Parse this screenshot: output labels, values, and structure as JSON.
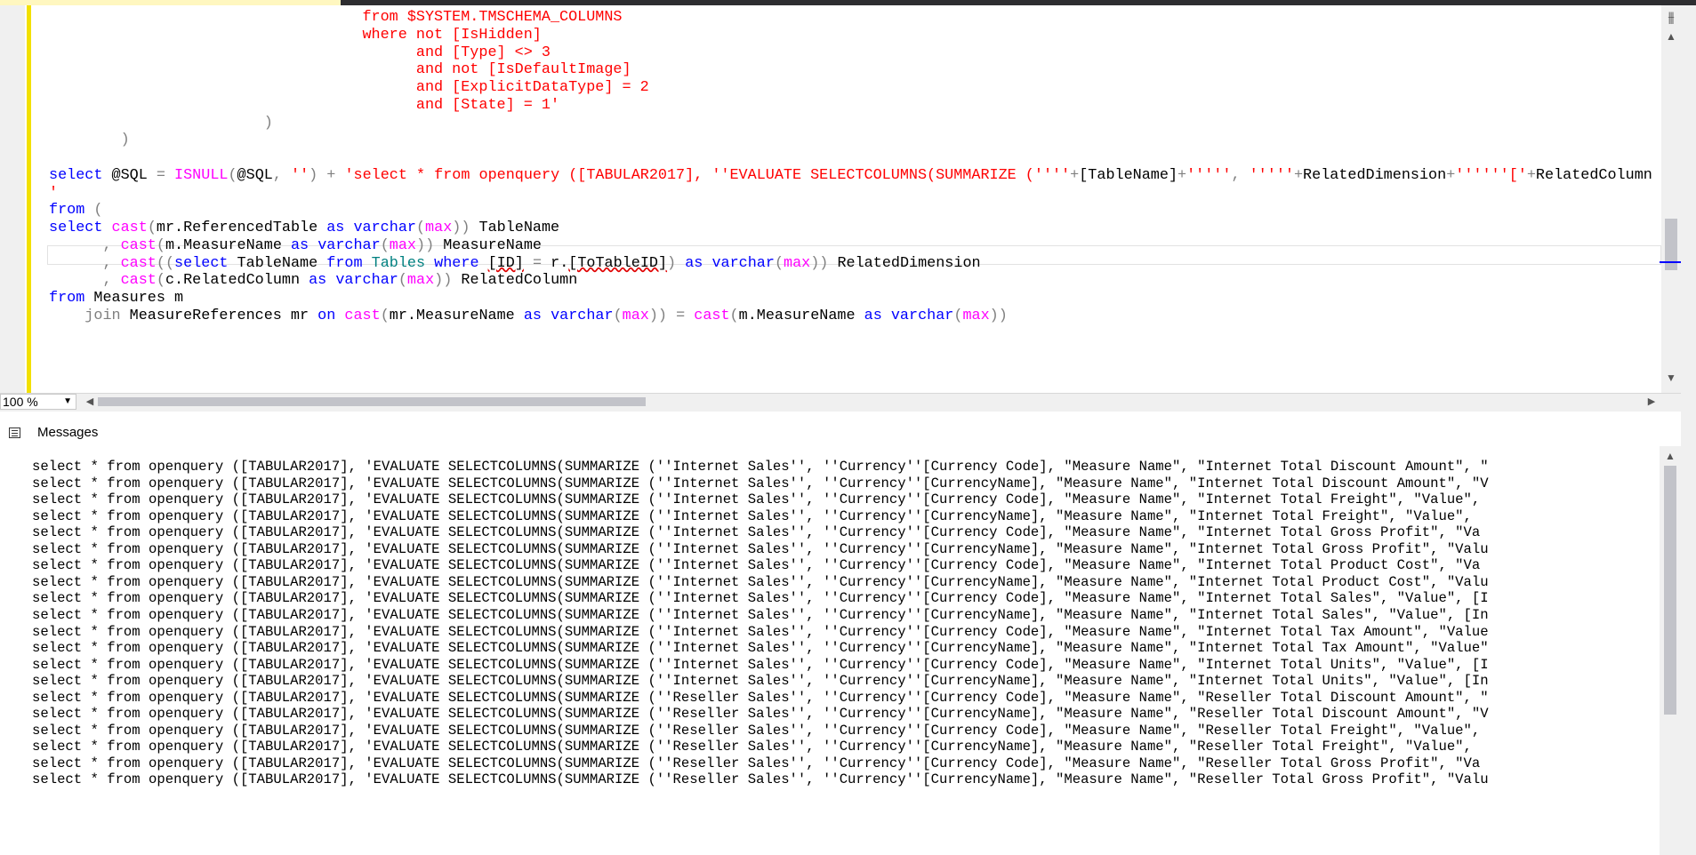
{
  "editor": {
    "lines": [
      [
        {
          "t": "                                   from $SYSTEM.TMSCHEMA_COLUMNS",
          "c": "str"
        }
      ],
      [
        {
          "t": "                                   where not [IsHidden]",
          "c": "str"
        }
      ],
      [
        {
          "t": "                                         and [Type] <> 3",
          "c": "str"
        }
      ],
      [
        {
          "t": "                                         and not [IsDefaultImage]",
          "c": "str"
        }
      ],
      [
        {
          "t": "                                         and [ExplicitDataType] = 2",
          "c": "str"
        }
      ],
      [
        {
          "t": "                                         and [State] = 1'",
          "c": "str"
        }
      ],
      [
        {
          "t": "                        )",
          "c": "op"
        }
      ],
      [
        {
          "t": "        )",
          "c": "op"
        }
      ],
      [],
      [
        {
          "t": "select",
          "c": "kw"
        },
        {
          "t": " @SQL "
        },
        {
          "t": "=",
          "c": "op"
        },
        {
          "t": " "
        },
        {
          "t": "ISNULL",
          "c": "fn"
        },
        {
          "t": "(",
          "c": "op"
        },
        {
          "t": "@SQL"
        },
        {
          "t": ", ",
          "c": "op"
        },
        {
          "t": "''",
          "c": "str"
        },
        {
          "t": ") + ",
          "c": "op"
        },
        {
          "t": "'select * from openquery ([TABULAR2017], ''EVALUATE SELECTCOLUMNS(SUMMARIZE (''''",
          "c": "str"
        },
        {
          "t": "+",
          "c": "op"
        },
        {
          "t": "[TableName]"
        },
        {
          "t": "+",
          "c": "op"
        },
        {
          "t": "'''''",
          "c": "str"
        },
        {
          "t": ", ",
          "c": "op"
        },
        {
          "t": "'''''",
          "c": "str"
        },
        {
          "t": "+",
          "c": "op"
        },
        {
          "t": "RelatedDimension"
        },
        {
          "t": "+",
          "c": "op"
        },
        {
          "t": "''''''['",
          "c": "str"
        },
        {
          "t": "+",
          "c": "op"
        },
        {
          "t": "RelatedColumn"
        }
      ],
      [
        {
          "t": "'",
          "c": "str"
        }
      ],
      [
        {
          "t": "from",
          "c": "kw"
        },
        {
          "t": " (",
          "c": "op"
        }
      ],
      [
        {
          "t": "select",
          "c": "kw"
        },
        {
          "t": " "
        },
        {
          "t": "cast",
          "c": "fn"
        },
        {
          "t": "(",
          "c": "op"
        },
        {
          "t": "mr.ReferencedTable "
        },
        {
          "t": "as",
          "c": "kw"
        },
        {
          "t": " "
        },
        {
          "t": "varchar",
          "c": "kw"
        },
        {
          "t": "(",
          "c": "op"
        },
        {
          "t": "max",
          "c": "fn"
        },
        {
          "t": "))",
          "c": "op"
        },
        {
          "t": " TableName"
        }
      ],
      [
        {
          "t": "      ",
          "c": ""
        },
        {
          "t": ",",
          "c": "op"
        },
        {
          "t": " "
        },
        {
          "t": "cast",
          "c": "fn"
        },
        {
          "t": "(",
          "c": "op"
        },
        {
          "t": "m.MeasureName "
        },
        {
          "t": "as",
          "c": "kw"
        },
        {
          "t": " "
        },
        {
          "t": "varchar",
          "c": "kw"
        },
        {
          "t": "(",
          "c": "op"
        },
        {
          "t": "max",
          "c": "fn"
        },
        {
          "t": "))",
          "c": "op"
        },
        {
          "t": " MeasureName"
        }
      ],
      [
        {
          "t": "      ",
          "c": ""
        },
        {
          "t": ",",
          "c": "op"
        },
        {
          "t": " "
        },
        {
          "t": "cast",
          "c": "fn"
        },
        {
          "t": "((",
          "c": "op"
        },
        {
          "t": "select",
          "c": "kw"
        },
        {
          "t": " TableName "
        },
        {
          "t": "from",
          "c": "kw"
        },
        {
          "t": " "
        },
        {
          "t": "Tables",
          "c": "tbl"
        },
        {
          "t": " "
        },
        {
          "t": "where",
          "c": "kw"
        },
        {
          "t": " "
        },
        {
          "t": "[ID]",
          "c": "sq"
        },
        {
          "t": " "
        },
        {
          "t": "=",
          "c": "op"
        },
        {
          "t": " r."
        },
        {
          "t": "[ToTableID]",
          "c": "sq"
        },
        {
          "t": ")",
          "c": "op"
        },
        {
          "t": " "
        },
        {
          "t": "as",
          "c": "kw"
        },
        {
          "t": " "
        },
        {
          "t": "varchar",
          "c": "kw"
        },
        {
          "t": "(",
          "c": "op"
        },
        {
          "t": "max",
          "c": "fn"
        },
        {
          "t": "))",
          "c": "op"
        },
        {
          "t": " RelatedDimension"
        }
      ],
      [
        {
          "t": "      ",
          "c": ""
        },
        {
          "t": ",",
          "c": "op"
        },
        {
          "t": " "
        },
        {
          "t": "cast",
          "c": "fn"
        },
        {
          "t": "(",
          "c": "op"
        },
        {
          "t": "c.RelatedColumn "
        },
        {
          "t": "as",
          "c": "kw"
        },
        {
          "t": " "
        },
        {
          "t": "varchar",
          "c": "kw"
        },
        {
          "t": "(",
          "c": "op"
        },
        {
          "t": "max",
          "c": "fn"
        },
        {
          "t": "))",
          "c": "op"
        },
        {
          "t": " RelatedColumn"
        }
      ],
      [
        {
          "t": "from",
          "c": "kw"
        },
        {
          "t": " Measures m"
        }
      ],
      [
        {
          "t": "    "
        },
        {
          "t": "join",
          "c": "op"
        },
        {
          "t": " MeasureReferences mr "
        },
        {
          "t": "on",
          "c": "kw"
        },
        {
          "t": " "
        },
        {
          "t": "cast",
          "c": "fn"
        },
        {
          "t": "(",
          "c": "op"
        },
        {
          "t": "mr.MeasureName "
        },
        {
          "t": "as",
          "c": "kw"
        },
        {
          "t": " "
        },
        {
          "t": "varchar",
          "c": "kw"
        },
        {
          "t": "(",
          "c": "op"
        },
        {
          "t": "max",
          "c": "fn"
        },
        {
          "t": "))",
          "c": "op"
        },
        {
          "t": " "
        },
        {
          "t": "=",
          "c": "op"
        },
        {
          "t": " "
        },
        {
          "t": "cast",
          "c": "fn"
        },
        {
          "t": "(",
          "c": "op"
        },
        {
          "t": "m.MeasureName "
        },
        {
          "t": "as",
          "c": "kw"
        },
        {
          "t": " "
        },
        {
          "t": "varchar",
          "c": "kw"
        },
        {
          "t": "(",
          "c": "op"
        },
        {
          "t": "max",
          "c": "fn"
        },
        {
          "t": "))",
          "c": "op"
        }
      ]
    ]
  },
  "zoom": {
    "value": "100 %"
  },
  "messages_tab": {
    "label": "Messages"
  },
  "messages": [
    "select * from openquery ([TABULAR2017], 'EVALUATE SELECTCOLUMNS(SUMMARIZE (''Internet Sales'', ''Currency''[Currency Code], \"Measure Name\", \"Internet Total Discount Amount\", \"",
    "select * from openquery ([TABULAR2017], 'EVALUATE SELECTCOLUMNS(SUMMARIZE (''Internet Sales'', ''Currency''[CurrencyName], \"Measure Name\", \"Internet Total Discount Amount\", \"V",
    "select * from openquery ([TABULAR2017], 'EVALUATE SELECTCOLUMNS(SUMMARIZE (''Internet Sales'', ''Currency''[Currency Code], \"Measure Name\", \"Internet Total Freight\", \"Value\",",
    "select * from openquery ([TABULAR2017], 'EVALUATE SELECTCOLUMNS(SUMMARIZE (''Internet Sales'', ''Currency''[CurrencyName], \"Measure Name\", \"Internet Total Freight\", \"Value\",",
    "select * from openquery ([TABULAR2017], 'EVALUATE SELECTCOLUMNS(SUMMARIZE (''Internet Sales'', ''Currency''[Currency Code], \"Measure Name\", \"Internet Total Gross Profit\", \"Va",
    "select * from openquery ([TABULAR2017], 'EVALUATE SELECTCOLUMNS(SUMMARIZE (''Internet Sales'', ''Currency''[CurrencyName], \"Measure Name\", \"Internet Total Gross Profit\", \"Valu",
    "select * from openquery ([TABULAR2017], 'EVALUATE SELECTCOLUMNS(SUMMARIZE (''Internet Sales'', ''Currency''[Currency Code], \"Measure Name\", \"Internet Total Product Cost\", \"Va",
    "select * from openquery ([TABULAR2017], 'EVALUATE SELECTCOLUMNS(SUMMARIZE (''Internet Sales'', ''Currency''[CurrencyName], \"Measure Name\", \"Internet Total Product Cost\", \"Valu",
    "select * from openquery ([TABULAR2017], 'EVALUATE SELECTCOLUMNS(SUMMARIZE (''Internet Sales'', ''Currency''[Currency Code], \"Measure Name\", \"Internet Total Sales\", \"Value\", [I",
    "select * from openquery ([TABULAR2017], 'EVALUATE SELECTCOLUMNS(SUMMARIZE (''Internet Sales'', ''Currency''[CurrencyName], \"Measure Name\", \"Internet Total Sales\", \"Value\", [In",
    "select * from openquery ([TABULAR2017], 'EVALUATE SELECTCOLUMNS(SUMMARIZE (''Internet Sales'', ''Currency''[Currency Code], \"Measure Name\", \"Internet Total Tax Amount\", \"Value",
    "select * from openquery ([TABULAR2017], 'EVALUATE SELECTCOLUMNS(SUMMARIZE (''Internet Sales'', ''Currency''[CurrencyName], \"Measure Name\", \"Internet Total Tax Amount\", \"Value\"",
    "select * from openquery ([TABULAR2017], 'EVALUATE SELECTCOLUMNS(SUMMARIZE (''Internet Sales'', ''Currency''[Currency Code], \"Measure Name\", \"Internet Total Units\", \"Value\", [I",
    "select * from openquery ([TABULAR2017], 'EVALUATE SELECTCOLUMNS(SUMMARIZE (''Internet Sales'', ''Currency''[CurrencyName], \"Measure Name\", \"Internet Total Units\", \"Value\", [In",
    "select * from openquery ([TABULAR2017], 'EVALUATE SELECTCOLUMNS(SUMMARIZE (''Reseller Sales'', ''Currency''[Currency Code], \"Measure Name\", \"Reseller Total Discount Amount\", \"",
    "select * from openquery ([TABULAR2017], 'EVALUATE SELECTCOLUMNS(SUMMARIZE (''Reseller Sales'', ''Currency''[CurrencyName], \"Measure Name\", \"Reseller Total Discount Amount\", \"V",
    "select * from openquery ([TABULAR2017], 'EVALUATE SELECTCOLUMNS(SUMMARIZE (''Reseller Sales'', ''Currency''[Currency Code], \"Measure Name\", \"Reseller Total Freight\", \"Value\",",
    "select * from openquery ([TABULAR2017], 'EVALUATE SELECTCOLUMNS(SUMMARIZE (''Reseller Sales'', ''Currency''[CurrencyName], \"Measure Name\", \"Reseller Total Freight\", \"Value\",",
    "select * from openquery ([TABULAR2017], 'EVALUATE SELECTCOLUMNS(SUMMARIZE (''Reseller Sales'', ''Currency''[Currency Code], \"Measure Name\", \"Reseller Total Gross Profit\", \"Va",
    "select * from openquery ([TABULAR2017], 'EVALUATE SELECTCOLUMNS(SUMMARIZE (''Reseller Sales'', ''Currency''[CurrencyName], \"Measure Name\", \"Reseller Total Gross Profit\", \"Valu"
  ],
  "icons": {
    "split": "split-view-icon",
    "messages": "messages-icon",
    "scroll_up": "scroll-up-icon",
    "scroll_down": "scroll-down-icon",
    "scroll_left": "scroll-left-icon",
    "scroll_right": "scroll-right-icon",
    "dropdown": "chevron-down-icon"
  },
  "colors": {
    "keyword": "#0000ff",
    "string": "#ff0000",
    "function": "#ff00ff",
    "table": "#008080",
    "operator": "#808080",
    "change_bar": "#f2e000"
  }
}
